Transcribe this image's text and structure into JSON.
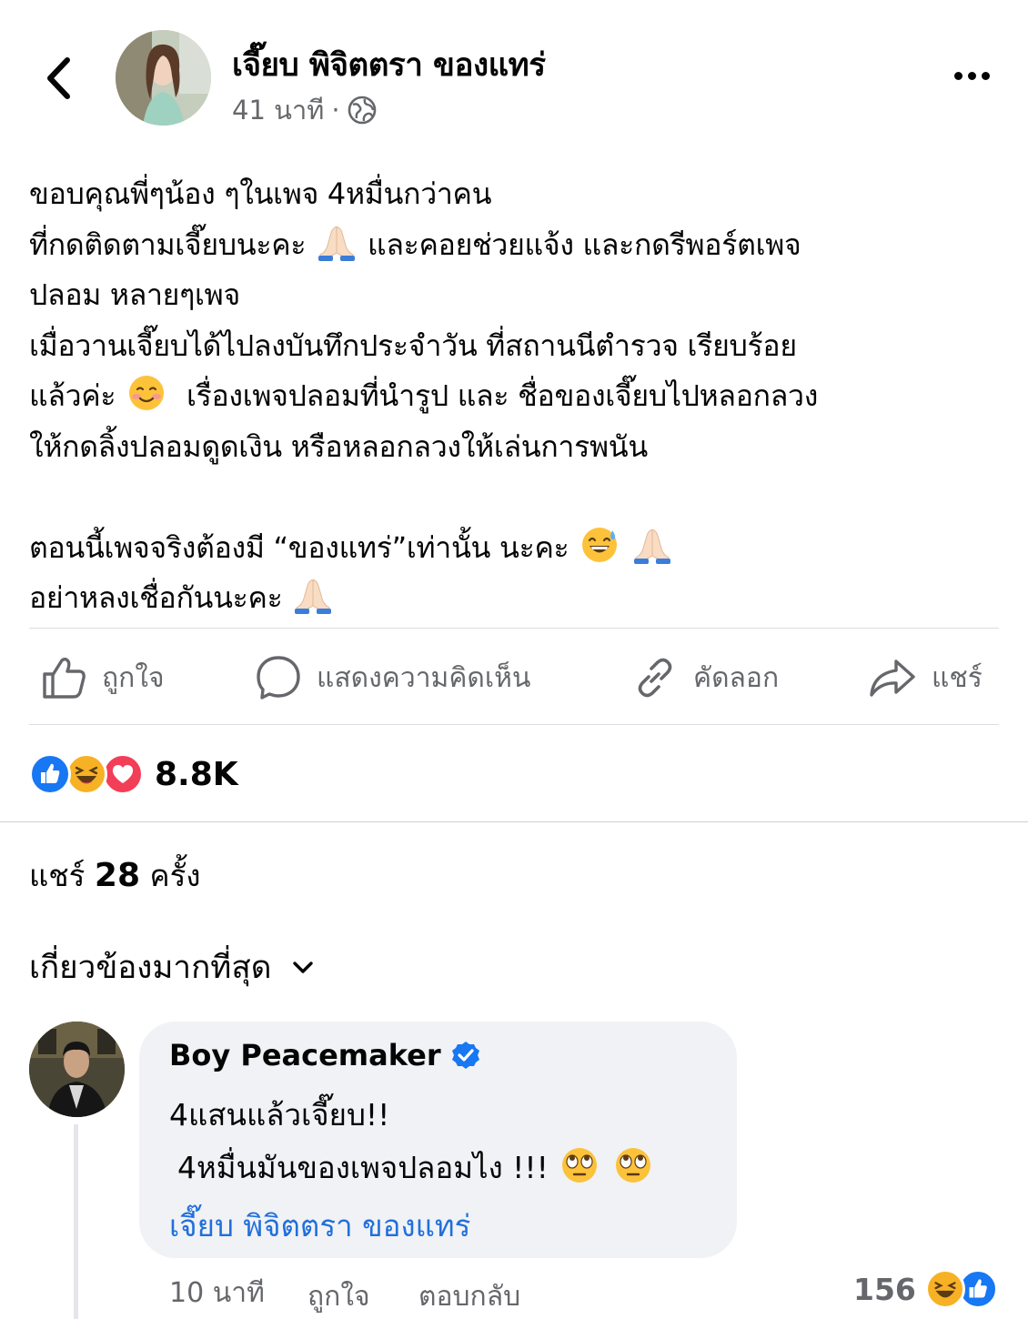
{
  "post": {
    "author": "เจี๊ยบ พิจิตตรา ของแทร่",
    "time": "41 นาที",
    "separator": "·",
    "body": {
      "line1": "ขอบคุณพี่ๆน้อง ๆในเพจ 4หมื่นกว่าคน",
      "line2a": "ที่กดติดตามเจี๊ยบนะคะ",
      "line2b": "และคอยช่วยแจ้ง และกดรีพอร์ตเพจ",
      "line3": "ปลอม หลายๆเพจ",
      "line4": "เมื่อวานเจี๊ยบได้ไปลงบันทึกประจำวัน ที่สถานนีตำรวจ เรียบร้อย",
      "line5a": "แล้วค่ะ",
      "line5b": "เรื่องเพจปลอมที่นำรูป และ ชื่อของเจี๊ยบไปหลอกลวง",
      "line6": "ให้กดลิ้งปลอมดูดเงิน หรือหลอกลวงให้เล่นการพนัน",
      "line7": "ตอนนี้เพจจริงต้องมี “ของแทร่”เท่านั้น นะคะ",
      "line8": "อย่าหลงเชื่อกันนะคะ"
    }
  },
  "actions": {
    "like": "ถูกใจ",
    "comment": "แสดงความคิดเห็น",
    "copy": "คัดลอก",
    "share": "แชร์"
  },
  "reactions": {
    "count": "8.8K",
    "types": [
      "like-icon",
      "haha-icon",
      "love-icon"
    ]
  },
  "shares": {
    "prefix": "แชร์",
    "count": "28",
    "suffix": "ครั้ง"
  },
  "sort": {
    "label": "เกี่ยวข้องมากที่สุด"
  },
  "comment": {
    "author": "Boy Peacemaker",
    "verified": true,
    "line1": "4แสนแล้วเจี๊ยบ!!",
    "line2": "4หมื่นมันของเพจปลอมไง !!!",
    "mention": "เจี๊ยบ พิจิตตรา ของแทร่",
    "time": "10 นาที",
    "like": "ถูกใจ",
    "reply": "ตอบกลับ",
    "reaction_count": "156"
  },
  "colors": {
    "text": "#050505",
    "secondary": "#65676b",
    "link": "#216fdb",
    "bubble": "#f0f2f5",
    "divider": "#dadde1",
    "like": "#1877f2",
    "love": "#f33e58",
    "haha": "#f7b125"
  }
}
